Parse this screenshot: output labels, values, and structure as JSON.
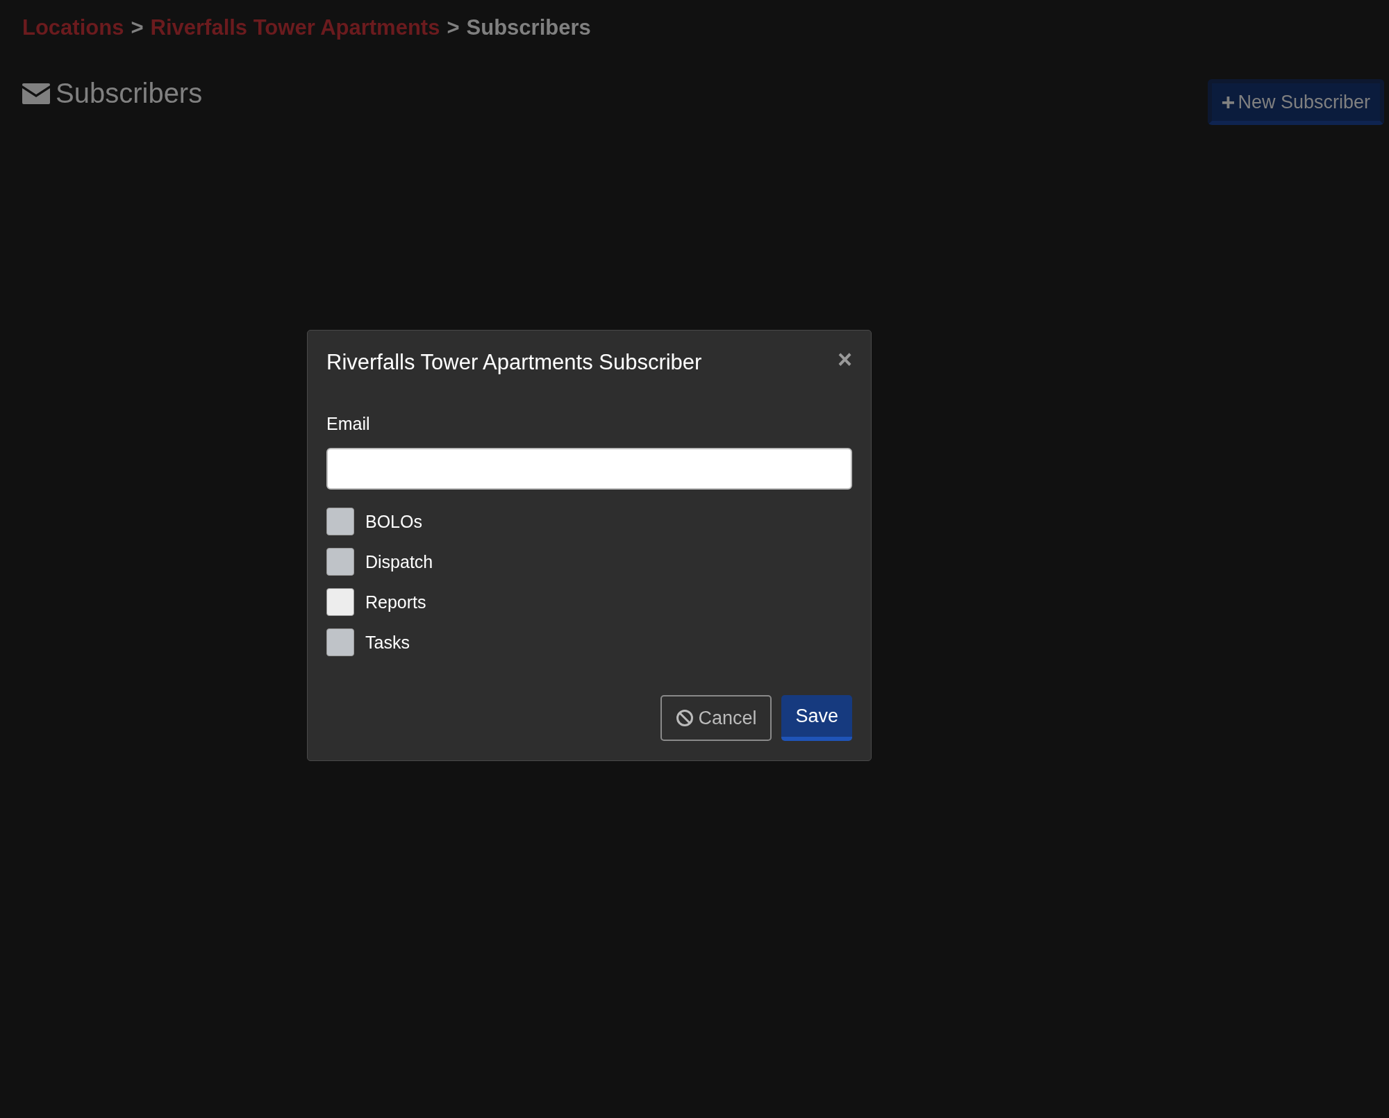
{
  "breadcrumb": [
    {
      "label": "Locations",
      "kind": "link"
    },
    {
      "label": ">",
      "kind": "separator"
    },
    {
      "label": "Riverfalls Tower Apartments",
      "kind": "link"
    },
    {
      "label": ">",
      "kind": "separator"
    },
    {
      "label": "Subscribers",
      "kind": "current"
    }
  ],
  "page_title": "Subscribers",
  "new_button": {
    "icon": "+",
    "label": "New Subscriber"
  },
  "modal": {
    "title": "Riverfalls Tower Apartments Subscriber",
    "close": "×",
    "email": {
      "label": "Email"
    },
    "options": [
      {
        "label": "BOLOs",
        "checked": false,
        "focused": false
      },
      {
        "label": "Dispatch",
        "checked": false,
        "focused": false
      },
      {
        "label": "Reports",
        "checked": false,
        "focused": true
      },
      {
        "label": "Tasks",
        "checked": false,
        "focused": false
      }
    ],
    "cancel": "Cancel",
    "save": "Save"
  }
}
